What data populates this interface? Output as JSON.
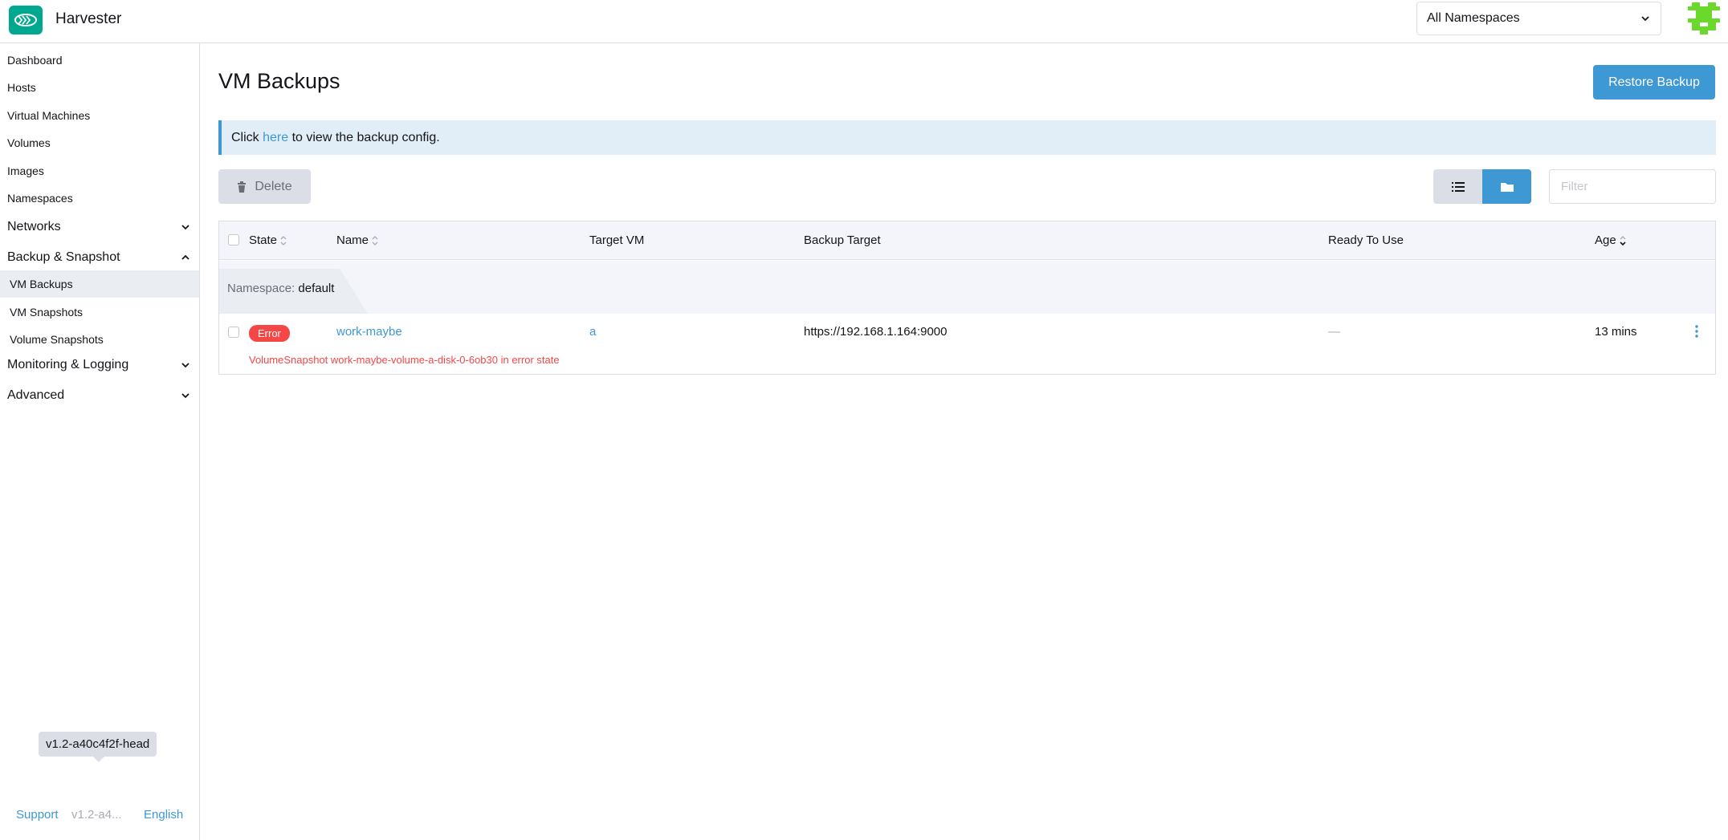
{
  "header": {
    "app_title": "Harvester",
    "namespace_select": "All Namespaces"
  },
  "sidebar": {
    "items": [
      {
        "label": "Dashboard"
      },
      {
        "label": "Hosts"
      },
      {
        "label": "Virtual Machines"
      },
      {
        "label": "Volumes"
      },
      {
        "label": "Images"
      },
      {
        "label": "Namespaces"
      }
    ],
    "groups": {
      "networks": "Networks",
      "backup_snapshot": "Backup & Snapshot",
      "monitoring_logging": "Monitoring & Logging",
      "advanced": "Advanced"
    },
    "backup_children": [
      {
        "label": "VM Backups",
        "active": true
      },
      {
        "label": "VM Snapshots"
      },
      {
        "label": "Volume Snapshots"
      }
    ],
    "version_tooltip": "v1.2-a40c4f2f-head",
    "footer": {
      "support": "Support",
      "version_short": "v1.2-a4...",
      "language": "English"
    }
  },
  "main": {
    "title": "VM Backups",
    "restore_button": "Restore Backup",
    "banner": {
      "prefix": "Click ",
      "link": "here",
      "suffix": " to view the backup config."
    },
    "delete_button": "Delete",
    "filter_placeholder": "Filter",
    "table": {
      "columns": {
        "state": "State",
        "name": "Name",
        "target_vm": "Target VM",
        "backup_target": "Backup Target",
        "ready_to_use": "Ready To Use",
        "age": "Age"
      },
      "group": {
        "key": "Namespace:",
        "value": "default"
      },
      "rows": [
        {
          "state": "Error",
          "name": "work-maybe",
          "target_vm": "a",
          "backup_target": "https://192.168.1.164:9000",
          "ready_to_use": "—",
          "age": "13 mins",
          "error_message": "VolumeSnapshot work-maybe-volume-a-disk-0-6ob30 in error state"
        }
      ]
    }
  },
  "colors": {
    "accent": "#3d98d3",
    "brand": "#00a88f",
    "error": "#f64747"
  }
}
